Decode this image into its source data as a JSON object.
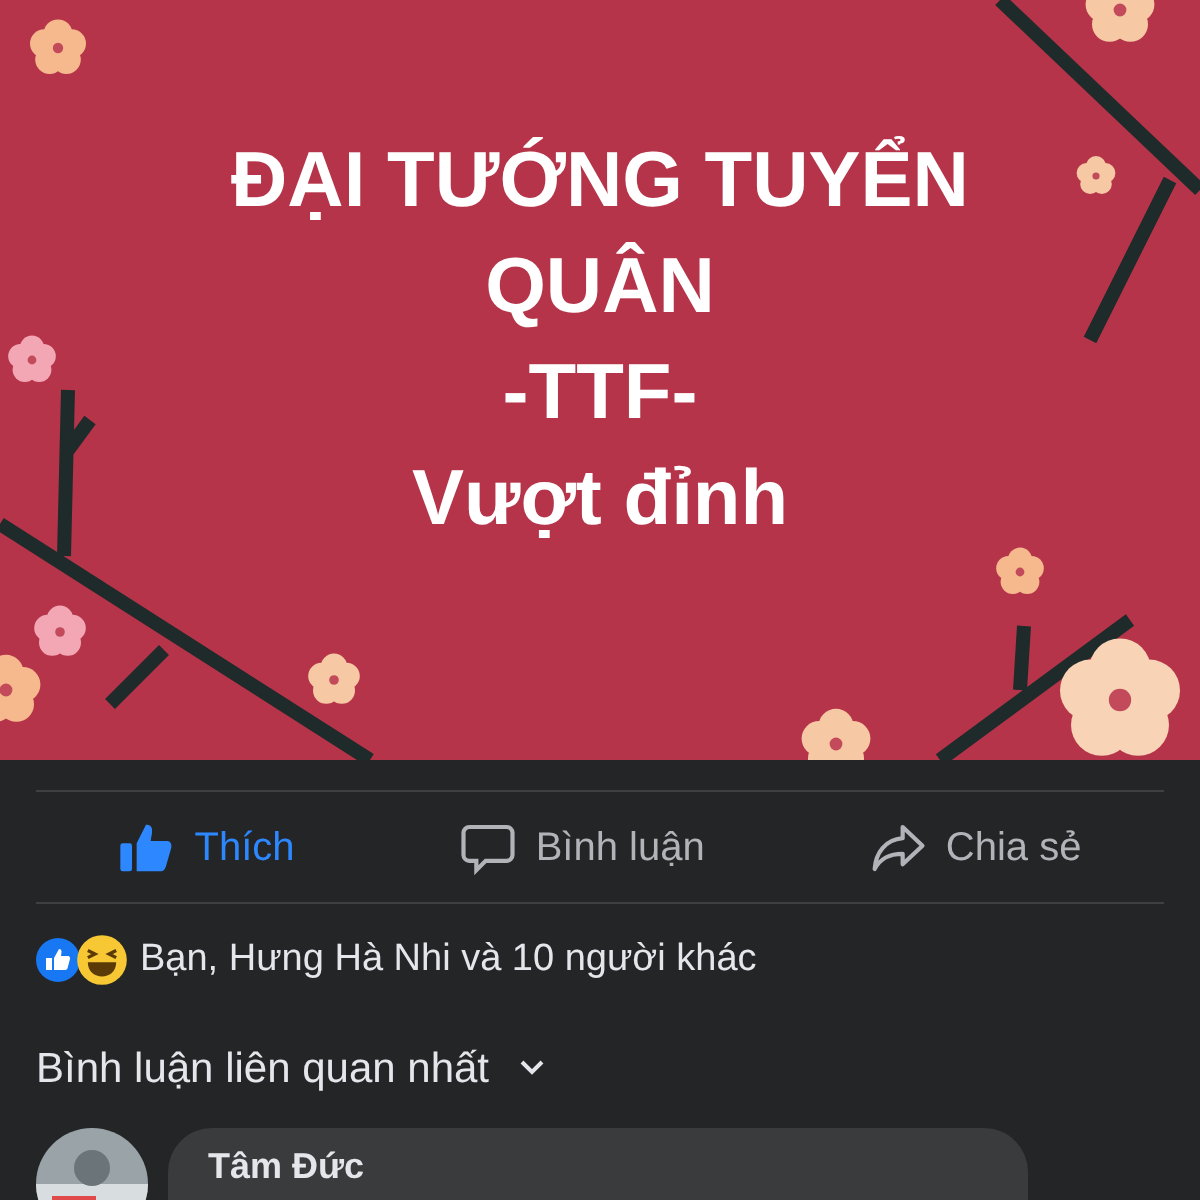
{
  "post": {
    "kind": "picture",
    "lines": [
      "ĐẠI TƯỚNG TUYỂN QUÂN",
      "-TTF-",
      "Vượt đỉnh"
    ]
  },
  "actions": [
    {
      "kind": "like",
      "label": "Thích",
      "selected": true
    },
    {
      "kind": "comment",
      "label": "Bình luận",
      "selected": false
    },
    {
      "kind": "share",
      "label": "Chia sẻ",
      "selected": false
    }
  ],
  "reactions": {
    "summary": "Bạn, Hưng Hà Nhi và 10 người khác"
  },
  "comment_sort": {
    "label": "Bình luận liên quan nhất"
  },
  "comments": [
    {
      "author": "Tâm Đức"
    }
  ]
}
